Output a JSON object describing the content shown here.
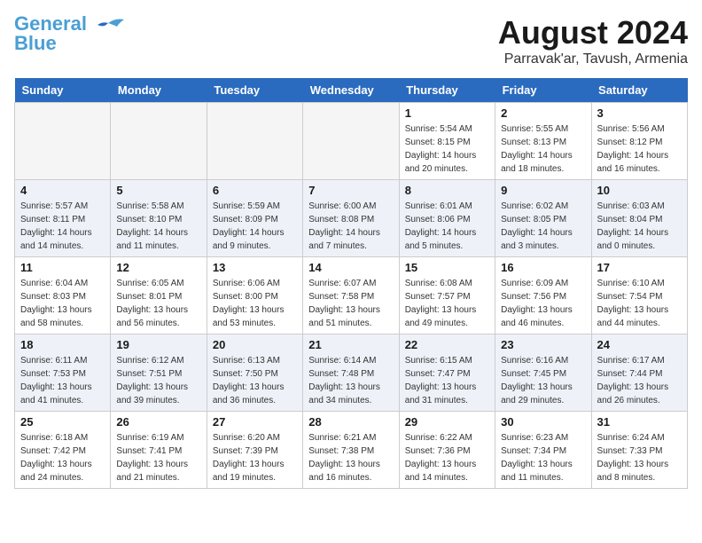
{
  "header": {
    "logo_line1": "General",
    "logo_line2": "Blue",
    "month_title": "August 2024",
    "location": "Parravak'ar, Tavush, Armenia"
  },
  "days_of_week": [
    "Sunday",
    "Monday",
    "Tuesday",
    "Wednesday",
    "Thursday",
    "Friday",
    "Saturday"
  ],
  "weeks": [
    [
      {
        "day": "",
        "info": ""
      },
      {
        "day": "",
        "info": ""
      },
      {
        "day": "",
        "info": ""
      },
      {
        "day": "",
        "info": ""
      },
      {
        "day": "1",
        "info": "Sunrise: 5:54 AM\nSunset: 8:15 PM\nDaylight: 14 hours\nand 20 minutes."
      },
      {
        "day": "2",
        "info": "Sunrise: 5:55 AM\nSunset: 8:13 PM\nDaylight: 14 hours\nand 18 minutes."
      },
      {
        "day": "3",
        "info": "Sunrise: 5:56 AM\nSunset: 8:12 PM\nDaylight: 14 hours\nand 16 minutes."
      }
    ],
    [
      {
        "day": "4",
        "info": "Sunrise: 5:57 AM\nSunset: 8:11 PM\nDaylight: 14 hours\nand 14 minutes."
      },
      {
        "day": "5",
        "info": "Sunrise: 5:58 AM\nSunset: 8:10 PM\nDaylight: 14 hours\nand 11 minutes."
      },
      {
        "day": "6",
        "info": "Sunrise: 5:59 AM\nSunset: 8:09 PM\nDaylight: 14 hours\nand 9 minutes."
      },
      {
        "day": "7",
        "info": "Sunrise: 6:00 AM\nSunset: 8:08 PM\nDaylight: 14 hours\nand 7 minutes."
      },
      {
        "day": "8",
        "info": "Sunrise: 6:01 AM\nSunset: 8:06 PM\nDaylight: 14 hours\nand 5 minutes."
      },
      {
        "day": "9",
        "info": "Sunrise: 6:02 AM\nSunset: 8:05 PM\nDaylight: 14 hours\nand 3 minutes."
      },
      {
        "day": "10",
        "info": "Sunrise: 6:03 AM\nSunset: 8:04 PM\nDaylight: 14 hours\nand 0 minutes."
      }
    ],
    [
      {
        "day": "11",
        "info": "Sunrise: 6:04 AM\nSunset: 8:03 PM\nDaylight: 13 hours\nand 58 minutes."
      },
      {
        "day": "12",
        "info": "Sunrise: 6:05 AM\nSunset: 8:01 PM\nDaylight: 13 hours\nand 56 minutes."
      },
      {
        "day": "13",
        "info": "Sunrise: 6:06 AM\nSunset: 8:00 PM\nDaylight: 13 hours\nand 53 minutes."
      },
      {
        "day": "14",
        "info": "Sunrise: 6:07 AM\nSunset: 7:58 PM\nDaylight: 13 hours\nand 51 minutes."
      },
      {
        "day": "15",
        "info": "Sunrise: 6:08 AM\nSunset: 7:57 PM\nDaylight: 13 hours\nand 49 minutes."
      },
      {
        "day": "16",
        "info": "Sunrise: 6:09 AM\nSunset: 7:56 PM\nDaylight: 13 hours\nand 46 minutes."
      },
      {
        "day": "17",
        "info": "Sunrise: 6:10 AM\nSunset: 7:54 PM\nDaylight: 13 hours\nand 44 minutes."
      }
    ],
    [
      {
        "day": "18",
        "info": "Sunrise: 6:11 AM\nSunset: 7:53 PM\nDaylight: 13 hours\nand 41 minutes."
      },
      {
        "day": "19",
        "info": "Sunrise: 6:12 AM\nSunset: 7:51 PM\nDaylight: 13 hours\nand 39 minutes."
      },
      {
        "day": "20",
        "info": "Sunrise: 6:13 AM\nSunset: 7:50 PM\nDaylight: 13 hours\nand 36 minutes."
      },
      {
        "day": "21",
        "info": "Sunrise: 6:14 AM\nSunset: 7:48 PM\nDaylight: 13 hours\nand 34 minutes."
      },
      {
        "day": "22",
        "info": "Sunrise: 6:15 AM\nSunset: 7:47 PM\nDaylight: 13 hours\nand 31 minutes."
      },
      {
        "day": "23",
        "info": "Sunrise: 6:16 AM\nSunset: 7:45 PM\nDaylight: 13 hours\nand 29 minutes."
      },
      {
        "day": "24",
        "info": "Sunrise: 6:17 AM\nSunset: 7:44 PM\nDaylight: 13 hours\nand 26 minutes."
      }
    ],
    [
      {
        "day": "25",
        "info": "Sunrise: 6:18 AM\nSunset: 7:42 PM\nDaylight: 13 hours\nand 24 minutes."
      },
      {
        "day": "26",
        "info": "Sunrise: 6:19 AM\nSunset: 7:41 PM\nDaylight: 13 hours\nand 21 minutes."
      },
      {
        "day": "27",
        "info": "Sunrise: 6:20 AM\nSunset: 7:39 PM\nDaylight: 13 hours\nand 19 minutes."
      },
      {
        "day": "28",
        "info": "Sunrise: 6:21 AM\nSunset: 7:38 PM\nDaylight: 13 hours\nand 16 minutes."
      },
      {
        "day": "29",
        "info": "Sunrise: 6:22 AM\nSunset: 7:36 PM\nDaylight: 13 hours\nand 14 minutes."
      },
      {
        "day": "30",
        "info": "Sunrise: 6:23 AM\nSunset: 7:34 PM\nDaylight: 13 hours\nand 11 minutes."
      },
      {
        "day": "31",
        "info": "Sunrise: 6:24 AM\nSunset: 7:33 PM\nDaylight: 13 hours\nand 8 minutes."
      }
    ]
  ]
}
